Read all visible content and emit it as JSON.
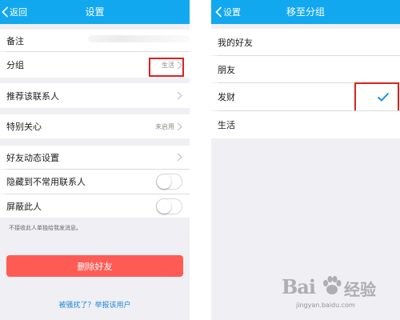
{
  "left": {
    "nav": {
      "back_label": "返回",
      "title": "设置"
    },
    "remark_label": "备注",
    "group_label": "分组",
    "group_value": "生活",
    "recommend_label": "推荐该联系人",
    "special_care_label": "特别关心",
    "special_care_value": "未启用",
    "friend_feed_label": "好友动态设置",
    "hide_label": "隐藏到不常用联系人",
    "hide_enabled": false,
    "block_label": "屏蔽此人",
    "block_enabled": false,
    "block_hint": "不接收此人单独给我发消息。",
    "delete_label": "删除好友",
    "report_label": "被骚扰了？举报该用户"
  },
  "right": {
    "nav": {
      "back_label": "设置",
      "title": "移至分组"
    },
    "groups": [
      "我的好友",
      "朋友",
      "发财",
      "生活"
    ],
    "selected_group": "发财"
  },
  "watermark": {
    "logo_text": "Bai",
    "logo_text2": "经验",
    "url": "jingyan.baidu.com"
  },
  "colors": {
    "nav_blue": "#12a8f0",
    "delete_red": "#ff5b55",
    "link_blue": "#1f8ad8",
    "highlight_red": "#e02020",
    "check_blue": "#1a8fe0"
  }
}
